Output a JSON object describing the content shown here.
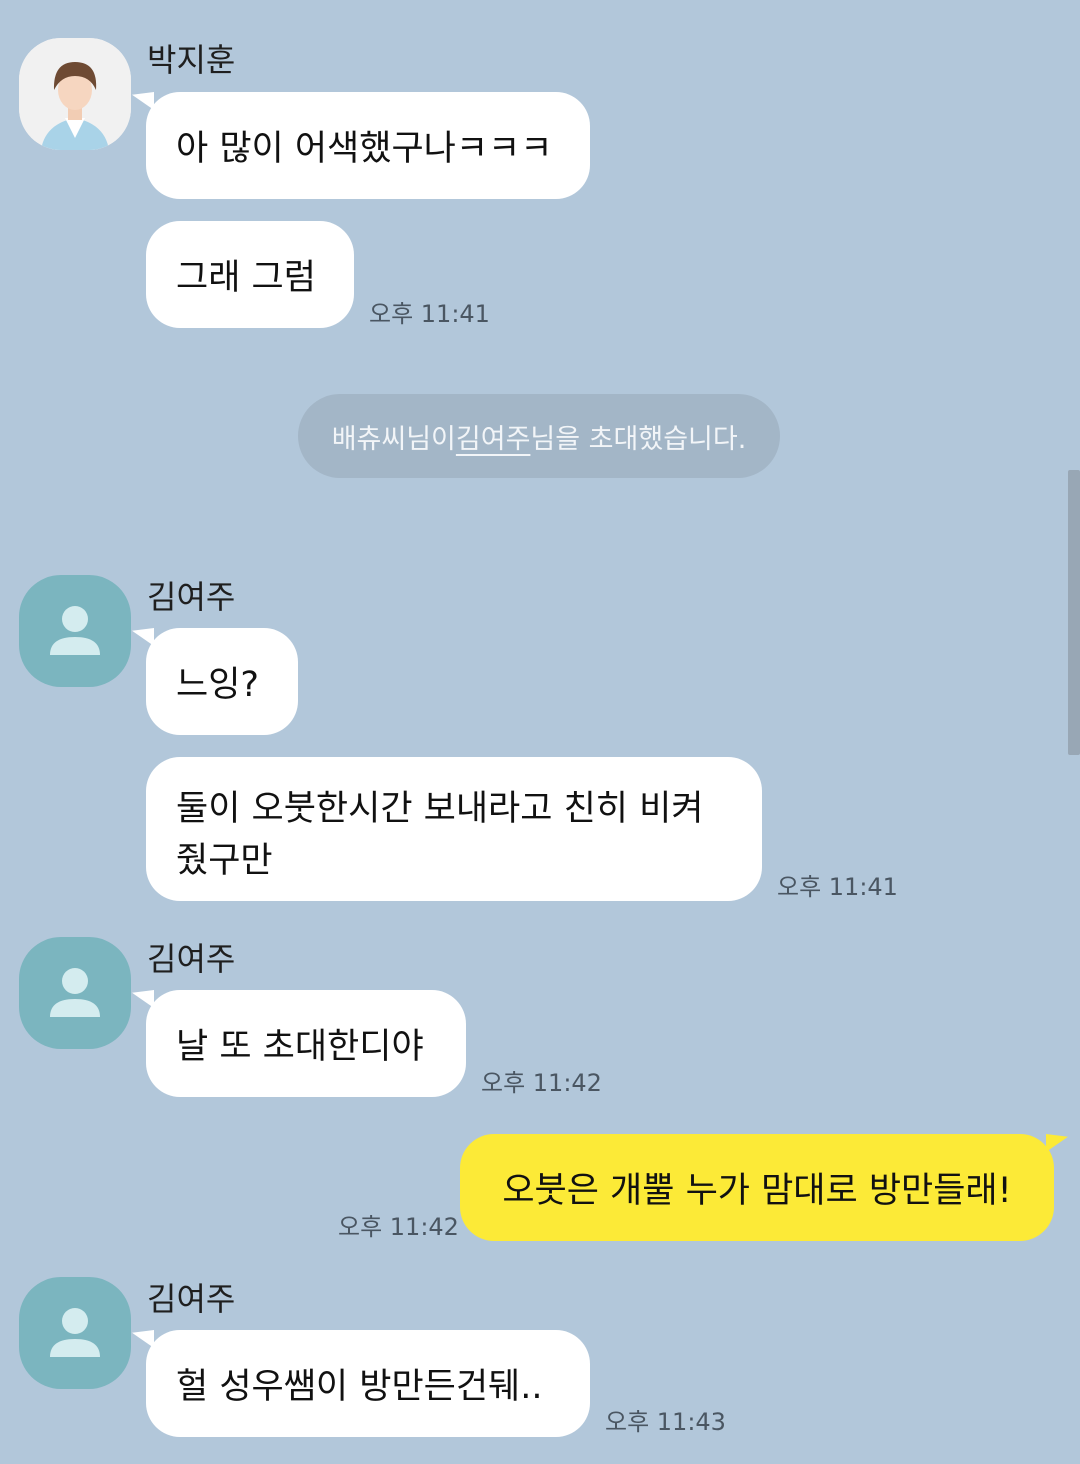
{
  "colors": {
    "background": "#b2c7da",
    "bubble_other": "#ffffff",
    "bubble_mine": "#fcea37",
    "notice_bg": "#a3b6c7",
    "default_avatar": "#7bb5bf"
  },
  "messages": {
    "m1": {
      "sender": "박지훈",
      "avatar_icon": "profile-photo",
      "texts": [
        "아 많이 어색했구나ㅋㅋㅋ",
        "그래 그럼"
      ],
      "time": "오후 11:41"
    },
    "notice": {
      "inviter": "배츄씨님이 ",
      "invitee": "김여주",
      "suffix": "님을 초대했습니다."
    },
    "m2": {
      "sender": "김여주",
      "avatar_icon": "default-person-icon",
      "texts": [
        "느잉?",
        "둘이 오붓한시간 보내라고 친히 비켜줬구만"
      ],
      "time": "오후 11:41"
    },
    "m3": {
      "sender": "김여주",
      "avatar_icon": "default-person-icon",
      "text": "날 또 초대한디야",
      "time": "오후 11:42"
    },
    "m4": {
      "sender": "me",
      "text": "오붓은 개뿔 누가 맘대로 방만들래!",
      "time": "오후 11:42"
    },
    "m5": {
      "sender": "김여주",
      "avatar_icon": "default-person-icon",
      "text": "헐 성우쌤이 방만든건뒈..",
      "time": "오후 11:43"
    }
  }
}
